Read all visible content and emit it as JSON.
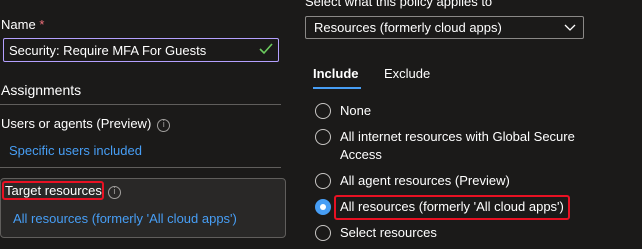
{
  "left_panel": {
    "name_label": "Name",
    "required_mark": "*",
    "name_value": "Security: Require MFA For Guests",
    "assignments_heading": "Assignments",
    "users_label": "Users or agents (Preview)",
    "users_link": "Specific users included",
    "target_label": "Target resources",
    "target_link": "All resources (formerly 'All cloud apps')"
  },
  "right_panel": {
    "applies_label": "Select what this policy applies to",
    "dropdown_value": "Resources (formerly cloud apps)",
    "tabs": [
      {
        "label": "Include",
        "active": true
      },
      {
        "label": "Exclude",
        "active": false
      }
    ],
    "options": [
      {
        "label": "None",
        "selected": false
      },
      {
        "label": "All internet resources with Global Secure Access",
        "selected": false
      },
      {
        "label": "All agent resources (Preview)",
        "selected": false
      },
      {
        "label": "All resources (formerly 'All cloud apps')",
        "selected": true
      },
      {
        "label": "Select resources",
        "selected": false
      }
    ]
  },
  "colors": {
    "background": "#1b1a19",
    "accent": "#479ef5",
    "highlight": "#e81123",
    "input_focus": "#b4a0ff",
    "valid_check": "#6ccb5f"
  }
}
